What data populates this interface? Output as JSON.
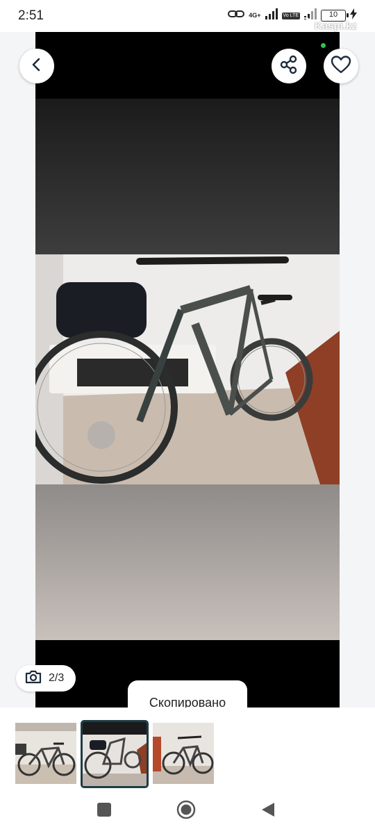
{
  "status_bar": {
    "time": "2:51",
    "network": "4G+",
    "volte": "Vo LTE",
    "battery": "10"
  },
  "watermark": "Kaspi.kz",
  "gallery": {
    "counter": "2/3",
    "toast": "Скопировано"
  },
  "colors": {
    "accent_border": "#1d3c45",
    "online_dot": "#33c24d"
  },
  "icons": [
    "back-icon",
    "share-icon",
    "heart-icon",
    "camera-icon",
    "square-icon",
    "circle-icon",
    "triangle-icon"
  ]
}
